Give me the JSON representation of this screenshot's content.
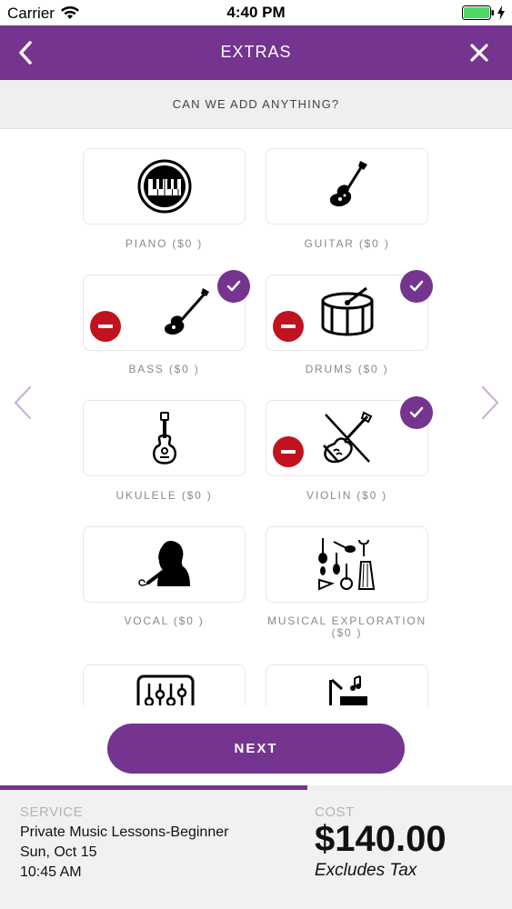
{
  "status_bar": {
    "carrier": "Carrier",
    "time": "4:40 PM"
  },
  "header": {
    "title": "EXTRAS"
  },
  "subheader": {
    "text": "CAN WE ADD ANYTHING?"
  },
  "extras": [
    {
      "label": "PIANO ($0 )",
      "icon": "piano-icon",
      "selected": false
    },
    {
      "label": "GUITAR ($0 )",
      "icon": "guitar-icon",
      "selected": false
    },
    {
      "label": "BASS ($0 )",
      "icon": "bass-guitar-icon",
      "selected": true
    },
    {
      "label": "DRUMS ($0 )",
      "icon": "drum-icon",
      "selected": true
    },
    {
      "label": "UKULELE ($0 )",
      "icon": "ukulele-icon",
      "selected": false
    },
    {
      "label": "VIOLIN ($0 )",
      "icon": "violin-icon",
      "selected": true
    },
    {
      "label": "VOCAL ($0 )",
      "icon": "vocal-singer-icon",
      "selected": false
    },
    {
      "label_line1": "MUSICAL EXPLORATION",
      "label_line2": "($0 )",
      "icon": "instruments-collection-icon",
      "selected": false
    },
    {
      "label": "",
      "icon": "mixer-sliders-icon",
      "selected": false
    },
    {
      "label": "",
      "icon": "music-notes-icon",
      "selected": false
    }
  ],
  "next_button": {
    "label": "NEXT"
  },
  "progress": {
    "fraction": 0.6
  },
  "footer": {
    "service_label": "SERVICE",
    "service_name": "Private Music Lessons-Beginner",
    "date": "Sun, Oct 15",
    "time": "10:45 AM",
    "cost_label": "COST",
    "price": "$140.00",
    "tax_note": "Excludes Tax"
  },
  "colors": {
    "accent": "#74348f",
    "remove": "#c1121f",
    "subheader_bg": "#efefef"
  }
}
